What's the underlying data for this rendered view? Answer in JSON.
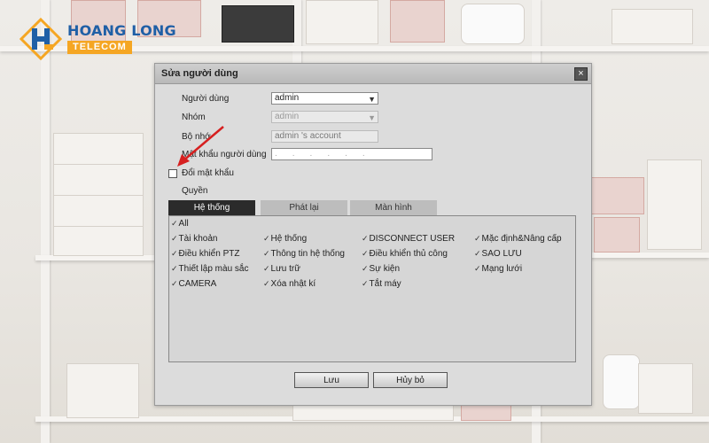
{
  "logo": {
    "title": "HOANG LONG",
    "subtitle": "TELECOM",
    "colors": {
      "primary": "#1f5fa6",
      "accent": "#f5a623"
    }
  },
  "dialog": {
    "title": "Sửa người dùng",
    "close_icon": "close-icon",
    "fields": {
      "user_label": "Người dùng",
      "user_value": "admin",
      "group_label": "Nhóm",
      "group_value": "admin",
      "memo_label": "Bộ nhớ",
      "memo_value": "admin 's account",
      "password_label": "Mật khẩu người dùng",
      "change_password_label": "Đổi mật khẩu",
      "rights_label": "Quyền"
    },
    "tabs": [
      {
        "label": "Hệ thống",
        "active": true
      },
      {
        "label": "Phát lại",
        "active": false
      },
      {
        "label": "Màn hình",
        "active": false
      }
    ],
    "permissions": {
      "all": "All",
      "col1": [
        "Tài khoản",
        "Điều khiển PTZ",
        "Thiết lập màu sắc",
        "CAMERA"
      ],
      "col2": [
        "Hệ thống",
        "Thông tin hệ thống",
        "Lưu trữ",
        "Xóa nhật kí"
      ],
      "col3": [
        "DISCONNECT USER",
        "Điều khiển thủ công",
        "Sự kiện",
        "Tắt máy"
      ],
      "col4": [
        "Mặc định&Nâng cấp",
        "SAO LƯU",
        "Mạng lưới"
      ]
    },
    "buttons": {
      "save": "Lưu",
      "cancel": "Hủy bỏ"
    },
    "annotation_color": "#d62020"
  }
}
